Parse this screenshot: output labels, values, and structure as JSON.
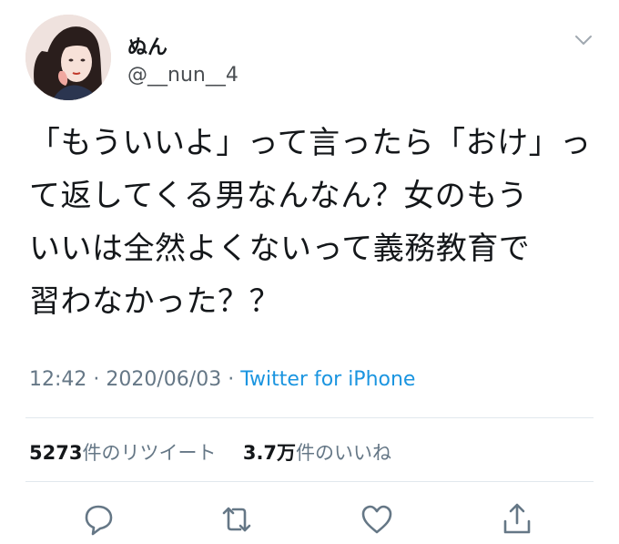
{
  "user": {
    "name": "ぬん",
    "handle": "@__nun__4",
    "avatar_icon": "profile-illustration-icon"
  },
  "tweet": {
    "lines": [
      "「もういいよ」って言ったら「おけ」っ",
      "て返してくる男なんなん？女のもう",
      "いいは全然よくないって義務教育で",
      "習わなかった？？"
    ]
  },
  "meta": {
    "time": "12:42",
    "separator1": "·",
    "date": "2020/06/03",
    "separator2": "·",
    "source": "Twitter for iPhone"
  },
  "stats": {
    "retweets_count": "5273",
    "retweets_label": "件のリツイート",
    "likes_count": "3.7万",
    "likes_label": "件のいいね"
  },
  "actions": [
    {
      "name": "reply",
      "icon": "reply-icon"
    },
    {
      "name": "retweet",
      "icon": "retweet-icon"
    },
    {
      "name": "like",
      "icon": "heart-icon"
    },
    {
      "name": "share",
      "icon": "share-icon"
    }
  ],
  "colors": {
    "link": "#1b95e0",
    "secondary": "#657786",
    "text": "#14171a",
    "divider": "#e1e8ed"
  }
}
